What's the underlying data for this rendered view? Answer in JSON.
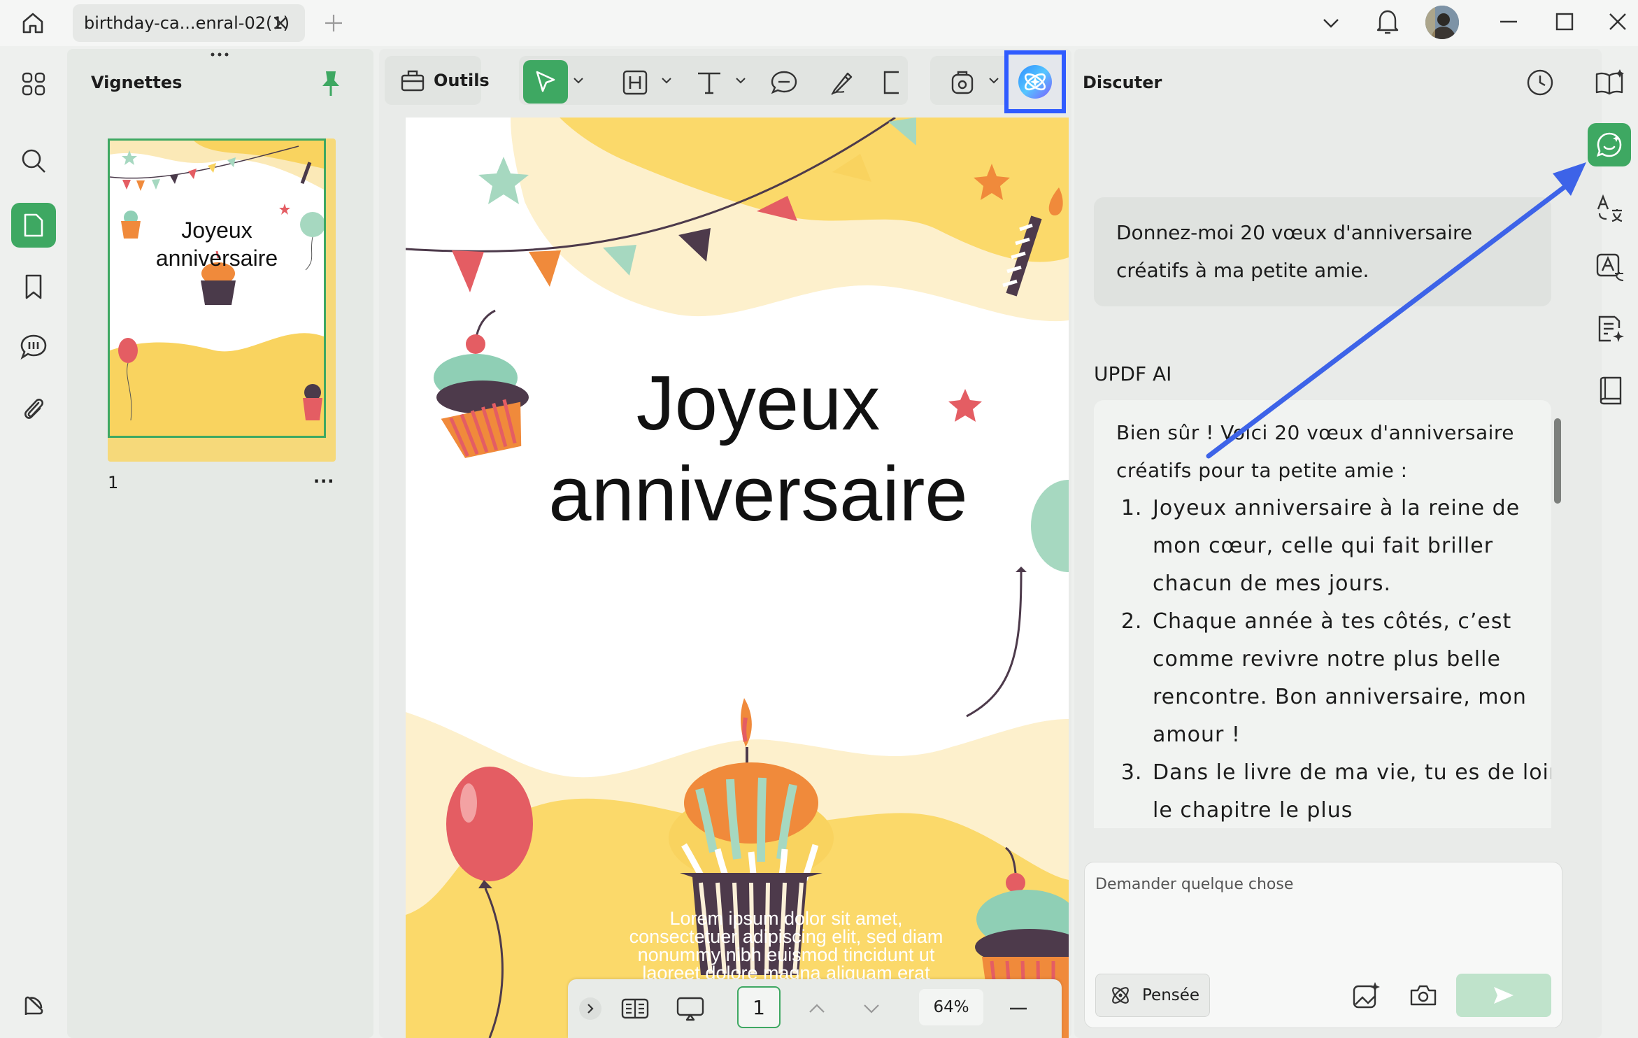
{
  "tab": {
    "title": "birthday-ca...enral-02(1)"
  },
  "thumbnails": {
    "title": "Vignettes",
    "page_number": "1",
    "more": "...",
    "thumb_title_line1": "Joyeux",
    "thumb_title_line2": "anniversaire"
  },
  "toolbar": {
    "tools_label": "Outils"
  },
  "document": {
    "heading_line1": "Joyeux",
    "heading_line2": "anniversaire",
    "lorem": [
      "Lorem ipsum dolor sit amet,",
      "consectetuer adipiscing elit, sed diam",
      "nonummy nibh euismod tincidunt ut",
      "laoreet dolore magna aliquam erat"
    ]
  },
  "bottom_bar": {
    "page_input": "1",
    "zoom": "64%"
  },
  "chat": {
    "title": "Discuter",
    "user_message": [
      "Donnez-moi 20 vœux d'anniversaire",
      "créatifs à ma petite amie."
    ],
    "ai_label": "UPDF AI",
    "ai_intro": [
      "Bien sûr ! Voici 20 vœux d'anniversaire",
      "créatifs pour ta petite amie :"
    ],
    "ai_items": [
      "Joyeux anniversaire à la reine de mon cœur, celle qui fait briller chacun de mes jours.",
      "Chaque année à tes côtés, c’est comme revivre notre plus belle rencontre. Bon anniversaire, mon amour !",
      "Dans le livre de ma vie, tu es de loin le chapitre le plus"
    ],
    "input_placeholder": "Demander quelque chose",
    "thinking_label": "Pensée"
  },
  "colors": {
    "accent_green": "#3ea862",
    "highlight_blue": "#2f5bff",
    "arrow_blue": "#3d63e8"
  }
}
